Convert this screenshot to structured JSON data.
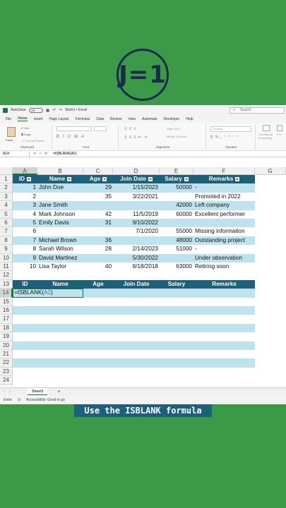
{
  "logo": {
    "text": "J=1"
  },
  "titlebar": {
    "autosave": "AutoSave",
    "autosave_state": "Off",
    "book": "Book1 • Excel",
    "search_placeholder": "Search"
  },
  "menu": [
    "File",
    "Home",
    "Insert",
    "Page Layout",
    "Formulas",
    "Data",
    "Review",
    "View",
    "Automate",
    "Developer",
    "Help"
  ],
  "ribbon": {
    "clipboard": {
      "label": "Clipboard",
      "paste": "Paste",
      "cut": "Cut",
      "copy": "Copy",
      "format_painter": "Format Painter"
    },
    "font": {
      "label": "Font"
    },
    "alignment": {
      "label": "Alignment",
      "wrap": "Wrap Text",
      "merge": "Merge & Center"
    },
    "number": {
      "label": "Number",
      "format": "General"
    },
    "styles": {
      "conditional": "Conditional Formatting",
      "format": "For..."
    }
  },
  "formula_bar": {
    "name_box": "A14",
    "fx": "fx",
    "value": "=ISBLANK(A2)"
  },
  "columns": [
    "A",
    "B",
    "C",
    "D",
    "E",
    "F",
    "G"
  ],
  "table": {
    "headers": [
      "ID",
      "Name",
      "Age",
      "Join Date",
      "Salary",
      "Remarks"
    ],
    "rows": [
      [
        "1",
        "John Doe",
        "29",
        "1/15/2023",
        "50000",
        "-"
      ],
      [
        "2",
        "",
        "35",
        "3/22/2021",
        "",
        "Promoted in 2022"
      ],
      [
        "3",
        "Jane Smith",
        "",
        "",
        "42000",
        "Left company"
      ],
      [
        "4",
        "Mark Johnson",
        "42",
        "11/5/2019",
        "60000",
        "Excellent performer"
      ],
      [
        "5",
        "Emily Davis",
        "31",
        "9/10/2022",
        "",
        ""
      ],
      [
        "6",
        "",
        "",
        "7/1/2020",
        "55000",
        "Missing information"
      ],
      [
        "7",
        "Michael Brown",
        "36",
        "",
        "48000",
        "Outstanding project"
      ],
      [
        "8",
        "Sarah Wilson",
        "28",
        "2/14/2023",
        "51000",
        "-"
      ],
      [
        "9",
        "David Martinez",
        "",
        "5/30/2022",
        "",
        "Under observation"
      ],
      [
        "10",
        "Lisa Taylor",
        "40",
        "8/18/2018",
        "63000",
        "Retiring soon"
      ]
    ]
  },
  "table2": {
    "headers": [
      "ID",
      "Name",
      "Age",
      "Join Date",
      "Salary",
      "Remarks"
    ],
    "formula_prefix": "=ISBLANK(",
    "formula_arg": "A2",
    "formula_suffix": ")"
  },
  "row_numbers": [
    "1",
    "2",
    "3",
    "4",
    "5",
    "6",
    "7",
    "8",
    "9",
    "10",
    "11",
    "12",
    "13",
    "14",
    "15",
    "16",
    "17",
    "18",
    "19",
    "20",
    "21",
    "22",
    "23",
    "24"
  ],
  "sheet": {
    "tab": "Sheet1",
    "add": "+"
  },
  "status": {
    "mode": "Enter",
    "accessibility": "Accessibility: Good to go"
  },
  "caption": "Use the ISBLANK formula",
  "colors": {
    "header": "#1e5f7a",
    "band": "#bfe3ee",
    "background": "#3a9a47",
    "accent": "#1d6f42"
  }
}
